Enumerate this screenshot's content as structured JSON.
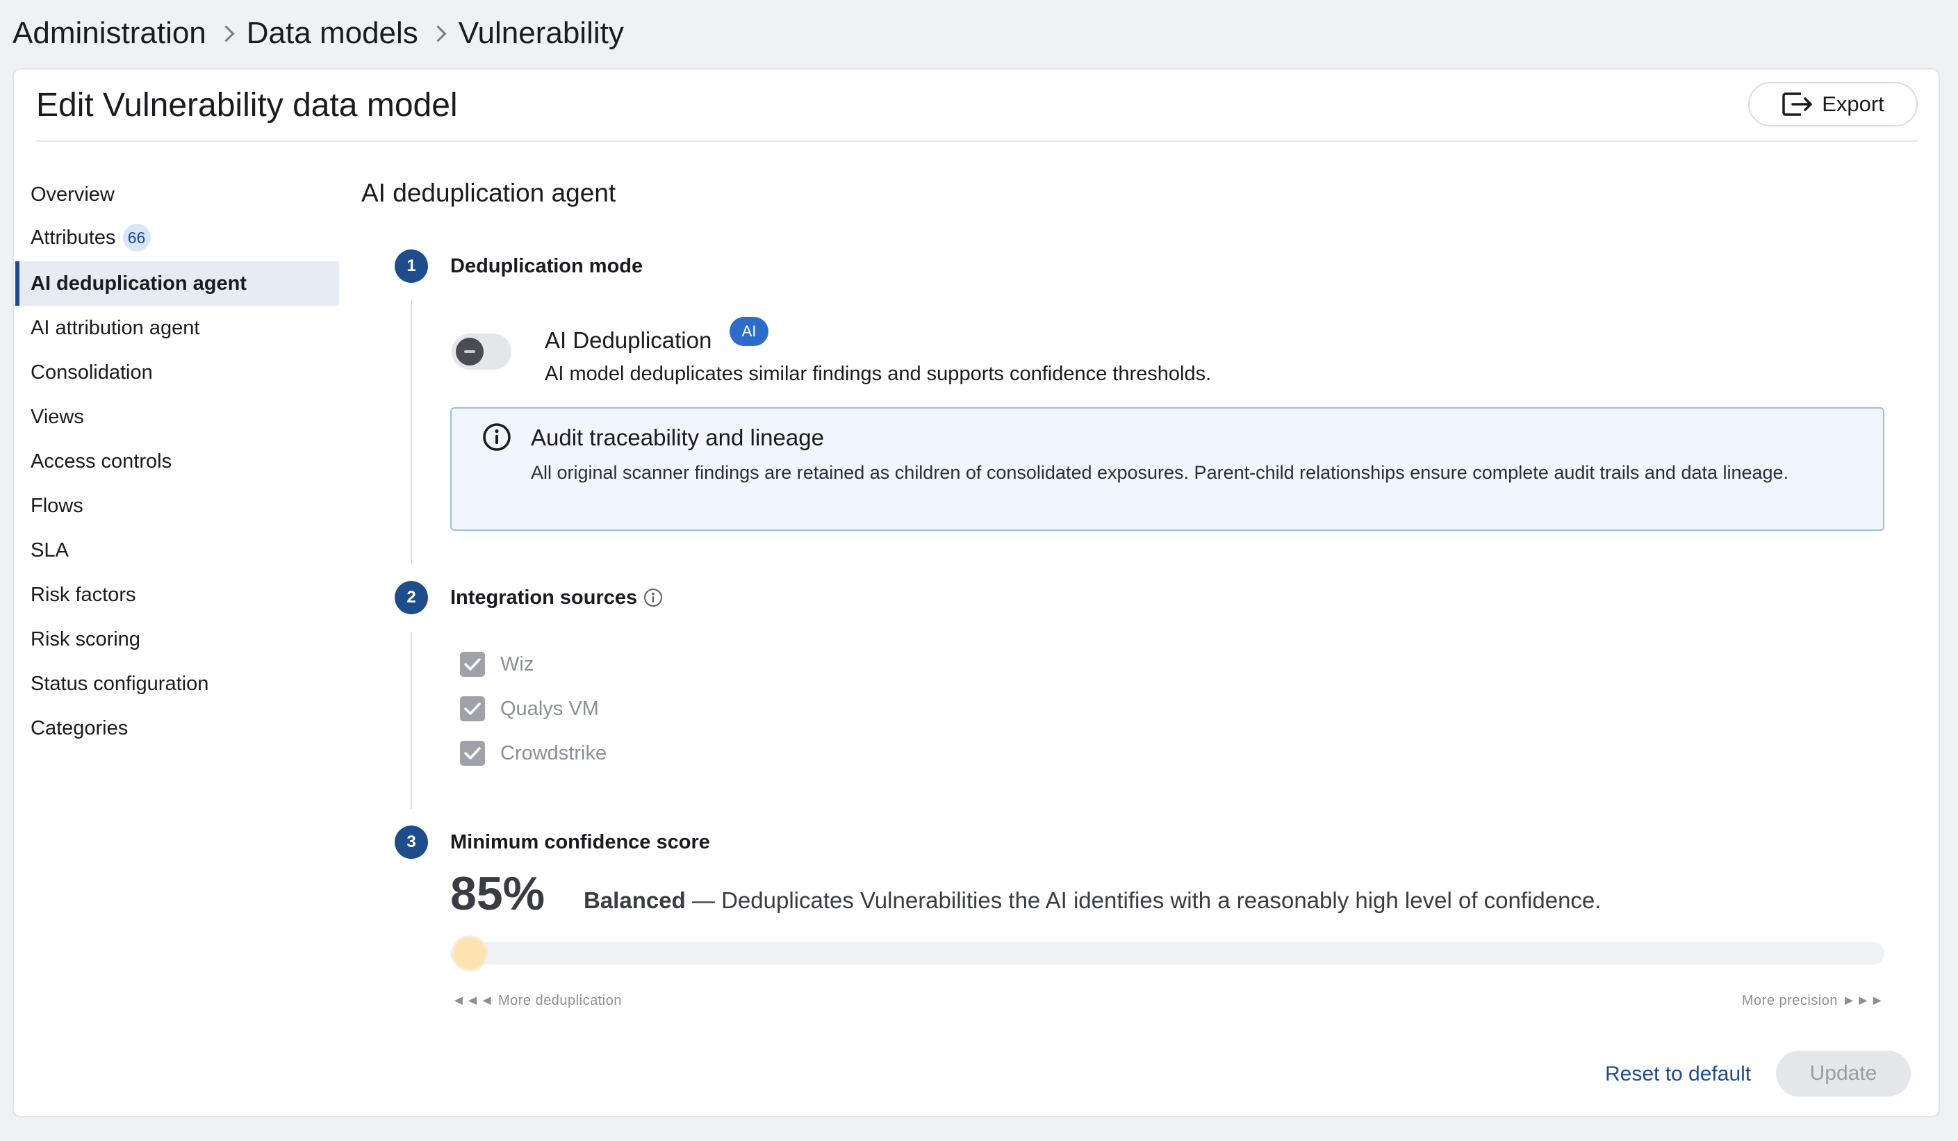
{
  "breadcrumb": [
    "Administration",
    "Data models",
    "Vulnerability"
  ],
  "page_title": "Edit Vulnerability data model",
  "export_label": "Export",
  "sidebar": {
    "items": [
      {
        "label": "Overview"
      },
      {
        "label": "Attributes",
        "badge": "66"
      },
      {
        "label": "AI deduplication agent",
        "active": true
      },
      {
        "label": "AI attribution agent"
      },
      {
        "label": "Consolidation"
      },
      {
        "label": "Views"
      },
      {
        "label": "Access controls"
      },
      {
        "label": "Flows"
      },
      {
        "label": "SLA"
      },
      {
        "label": "Risk factors"
      },
      {
        "label": "Risk scoring"
      },
      {
        "label": "Status configuration"
      },
      {
        "label": "Categories"
      }
    ]
  },
  "section_title": "AI deduplication agent",
  "steps": [
    {
      "number": "1",
      "label": "Deduplication mode"
    },
    {
      "number": "2",
      "label": "Integration sources"
    },
    {
      "number": "3",
      "label": "Minimum confidence score"
    }
  ],
  "dedup": {
    "title": "AI Deduplication",
    "badge": "AI",
    "description": "AI model deduplicates similar findings and supports confidence thresholds.",
    "enabled": false
  },
  "info": {
    "title": "Audit traceability and lineage",
    "text": "All original scanner findings are retained as children of consolidated exposures. Parent-child relationships ensure complete audit trails and data lineage."
  },
  "sources": [
    {
      "label": "Wiz",
      "checked": true
    },
    {
      "label": "Qualys VM",
      "checked": true
    },
    {
      "label": "Crowdstrike",
      "checked": true
    }
  ],
  "confidence": {
    "value_label": "85%",
    "level": "Balanced",
    "description": " — Deduplicates Vulnerabilities the AI identifies with a reasonably high level of confidence.",
    "left_hint": "◄◄◄ More deduplication",
    "right_hint": "More precision ►►►",
    "slider_position": 0
  },
  "actions": {
    "reset_label": "Reset to default",
    "update_label": "Update"
  },
  "colors": {
    "accent": "#1f4d8c",
    "ai_badge": "#2d6cc9",
    "slider_thumb": "#fde3b0"
  }
}
